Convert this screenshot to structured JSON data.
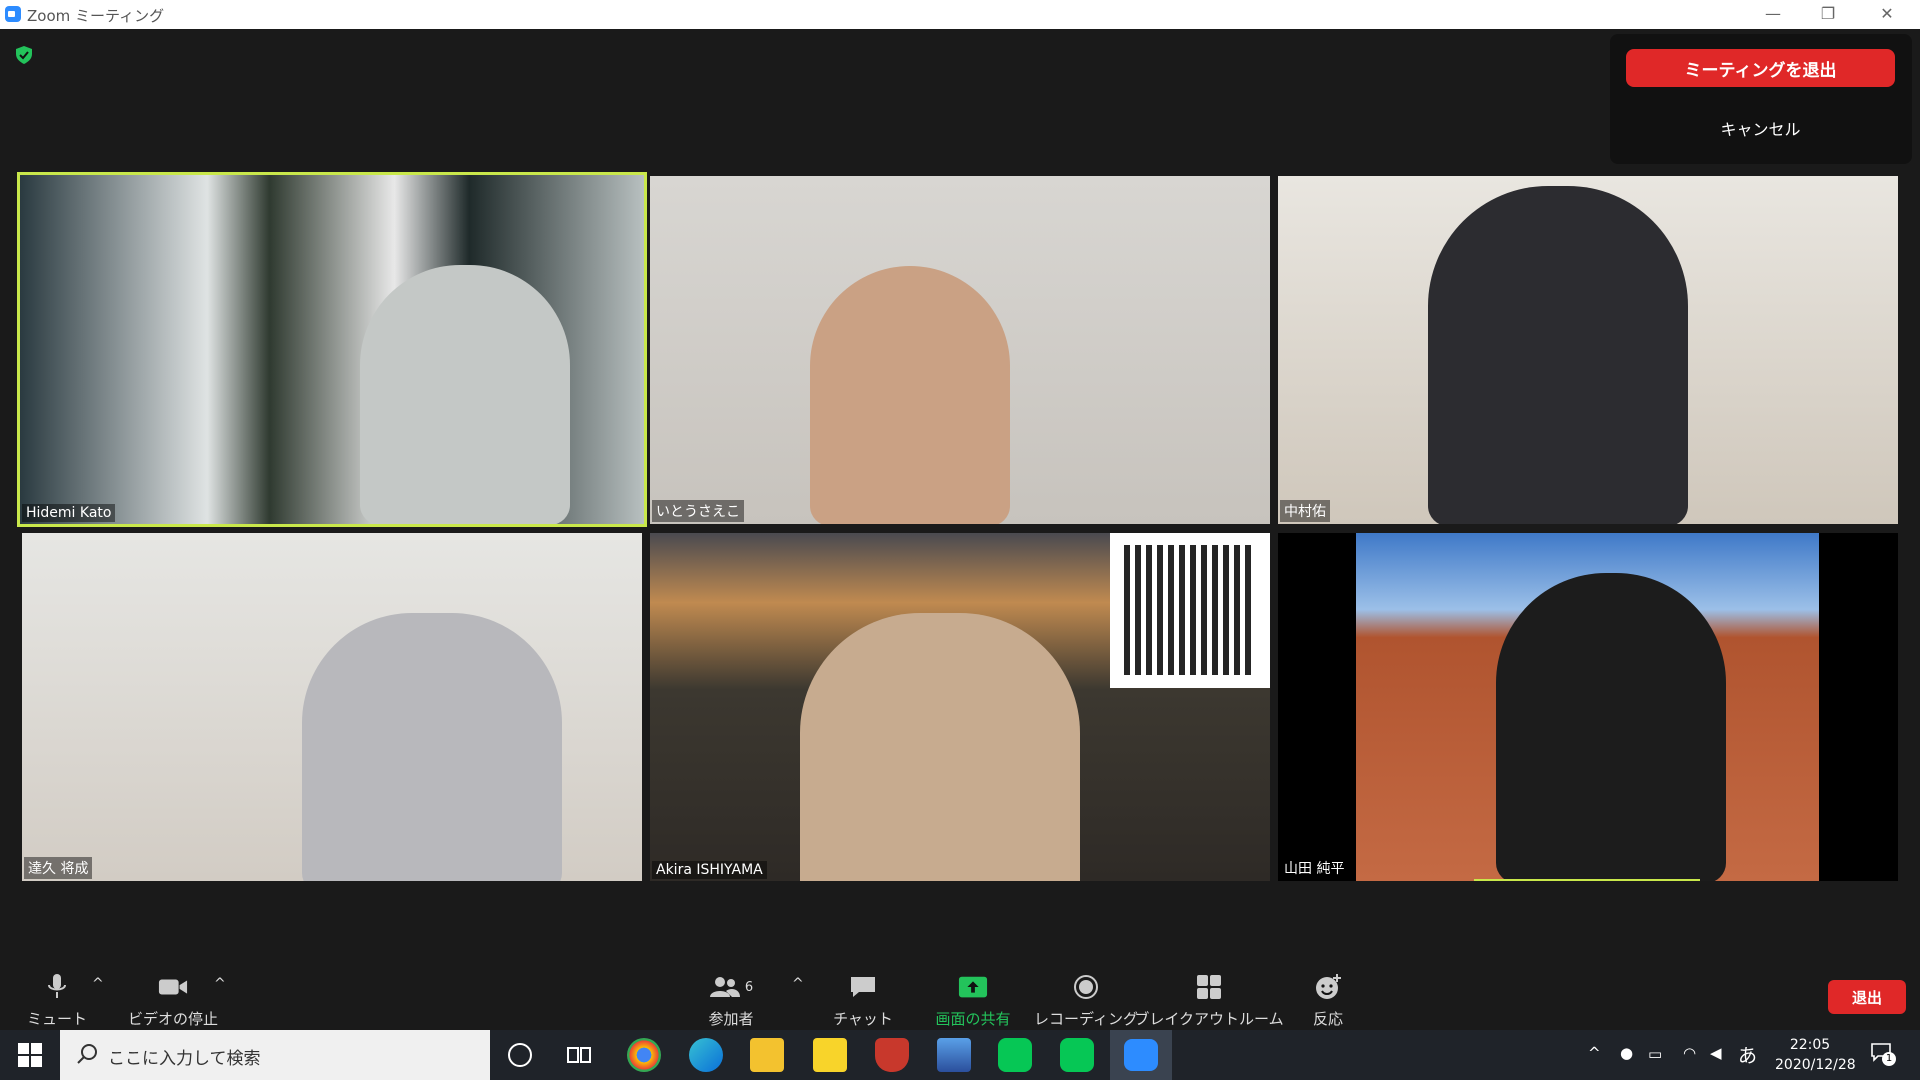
{
  "window": {
    "title": "Zoom ミーティング"
  },
  "leave_dialog": {
    "leave_label": "ミーティングを退出",
    "cancel_label": "キャンセル"
  },
  "participants": [
    {
      "name": "Hidemi Kato"
    },
    {
      "name": "いとうさえこ"
    },
    {
      "name": "中村佑"
    },
    {
      "name": "達久 将成"
    },
    {
      "name": "Akira ISHIYAMA"
    },
    {
      "name": "山田 純平"
    }
  ],
  "toolbar": {
    "mute_label": "ミュート",
    "video_label": "ビデオの停止",
    "participants_label": "参加者",
    "participants_count": "6",
    "chat_label": "チャット",
    "share_label": "画面の共有",
    "record_label": "レコーディング",
    "breakout_label": "ブレイクアウトルーム",
    "reactions_label": "反応",
    "exit_label": "退出"
  },
  "taskbar": {
    "search_placeholder": "ここに入力して検索",
    "time": "22:05",
    "date": "2020/12/28",
    "ime": "あ",
    "notifications": "1"
  },
  "colors": {
    "leave_red": "#e02828",
    "share_green": "#23c35b",
    "speaker_highlight": "#c9e84b"
  }
}
